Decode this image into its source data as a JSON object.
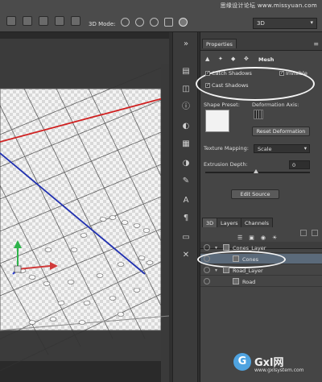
{
  "watermark_top": "思缘设计论坛 www.missyuan.com",
  "toolbar": {
    "mode_label": "3D Mode:",
    "view_select": "3D"
  },
  "properties": {
    "tab_label": "Properties",
    "section_title": "Mesh",
    "catch_shadows": "Catch Shadows",
    "cast_shadows": "Cast Shadows",
    "invisible": "Invisible",
    "shape_preset": "Shape Preset:",
    "deformation_axis": "Deformation Axis:",
    "reset_deformation": "Reset Deformation",
    "texture_mapping": "Texture Mapping:",
    "texture_mapping_value": "Scale",
    "extrusion_depth": "Extrusion Depth:",
    "extrusion_depth_value": "0",
    "edit_source": "Edit Source"
  },
  "layers_panel": {
    "tabs": [
      "3D",
      "Layers",
      "Channels"
    ],
    "rows": [
      {
        "name": "Cones_Layer",
        "indent": 0
      },
      {
        "name": "Cones",
        "indent": 1
      },
      {
        "name": "Road_Layer",
        "indent": 0
      },
      {
        "name": "Road",
        "indent": 1
      }
    ]
  },
  "bottom_watermark": {
    "logo": "G",
    "name": "Gxl网",
    "url": "www.gxlsystem.com"
  },
  "colors": {
    "red_axis": "#d02020",
    "blue_axis": "#2030b0",
    "selection_blue": "#5b6a7a"
  }
}
